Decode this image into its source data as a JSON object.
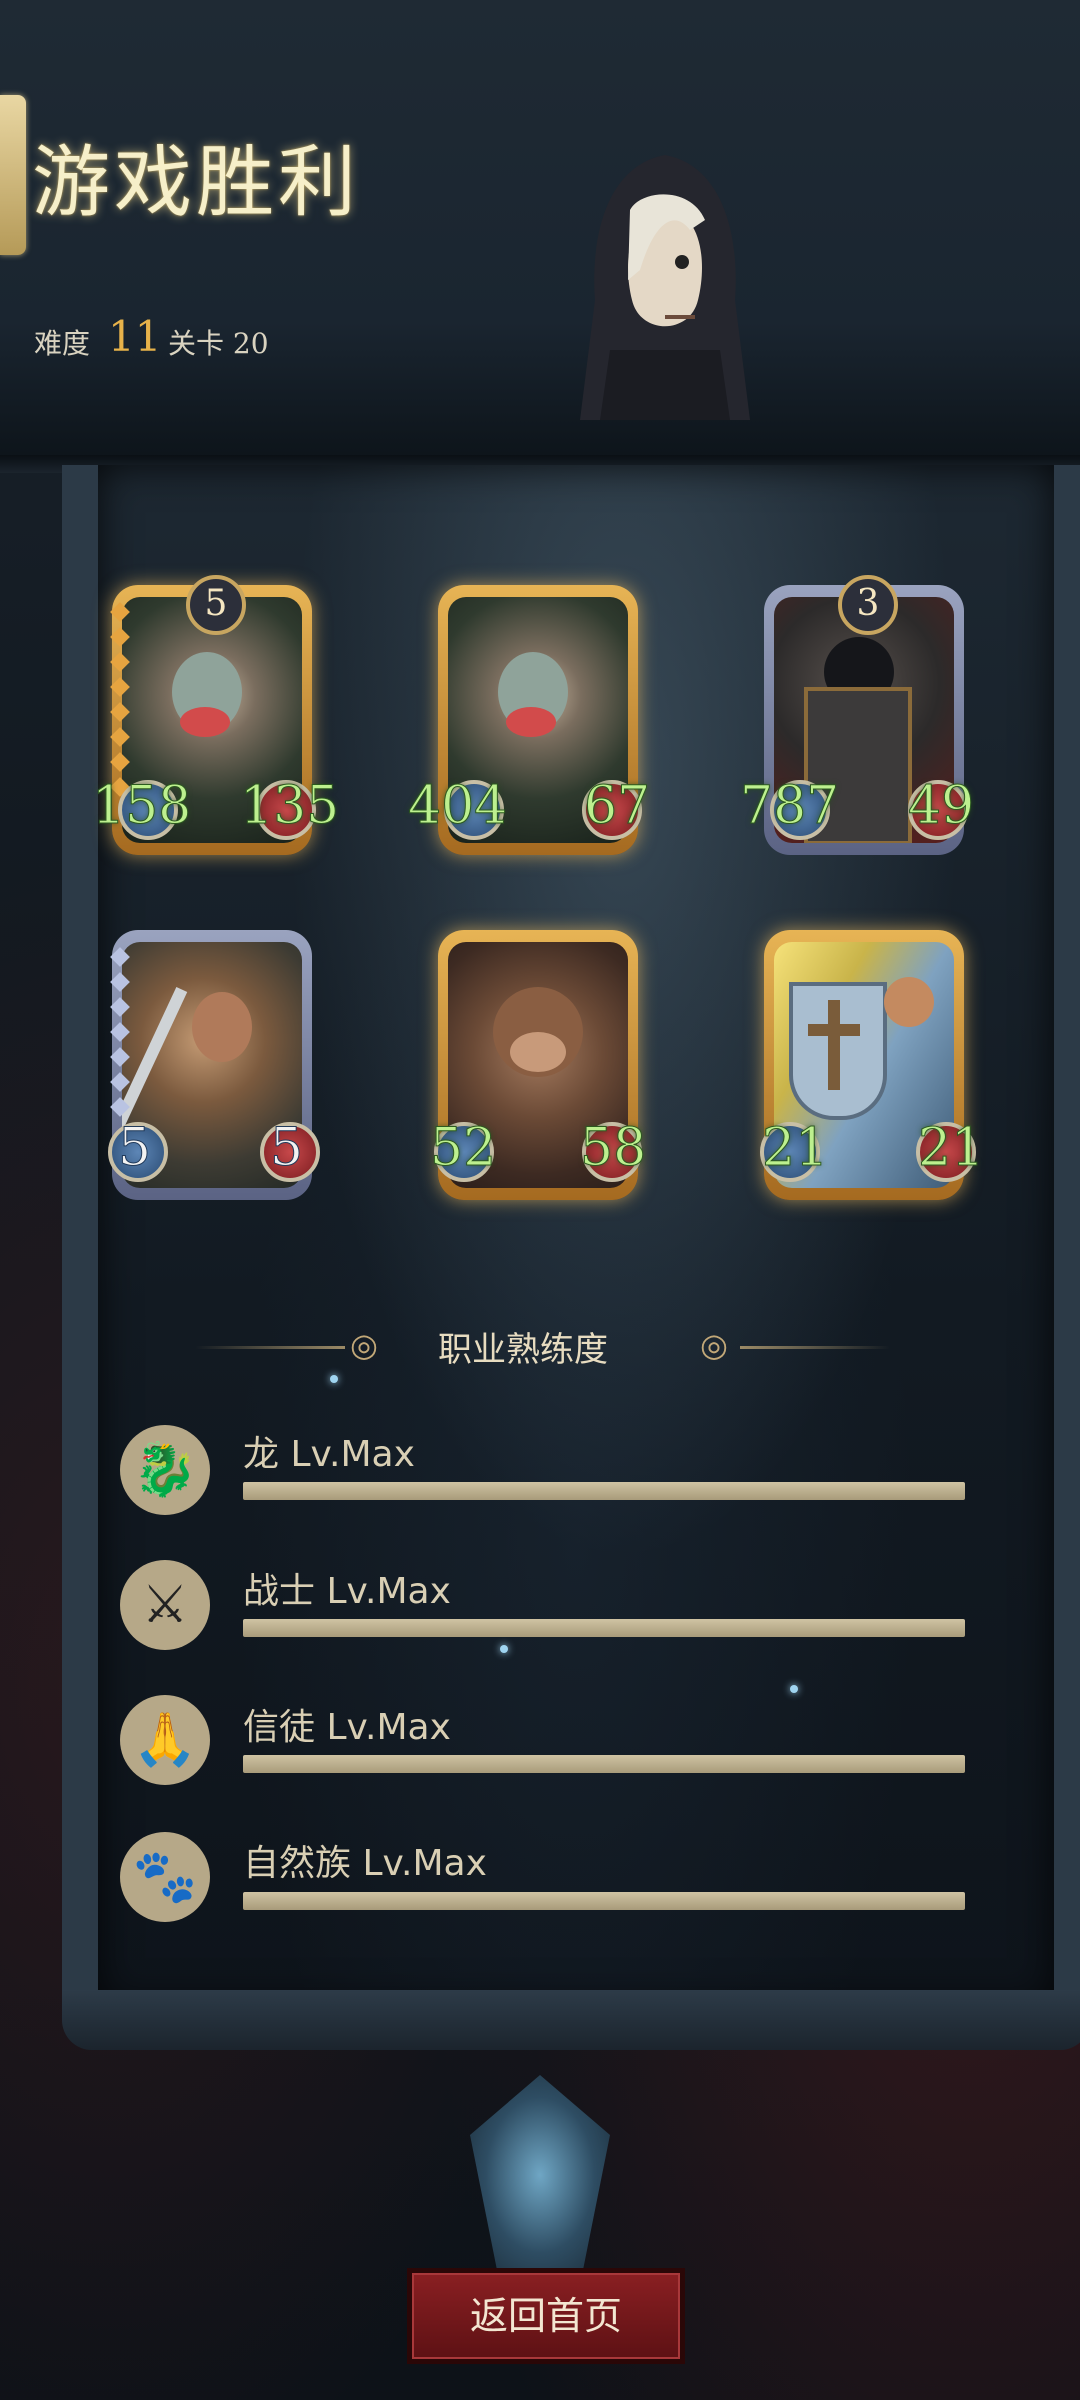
{
  "header": {
    "title": "游戏胜利",
    "difficulty_label": "难度",
    "difficulty_value": "11",
    "stage_label": "关卡 20"
  },
  "cards": [
    {
      "level": "5",
      "atk": "158",
      "hp": "135"
    },
    {
      "atk": "404",
      "hp": "67"
    },
    {
      "level": "3",
      "atk": "787",
      "hp": "49"
    },
    {
      "atk": "5",
      "hp": "5"
    },
    {
      "atk": "52",
      "hp": "58"
    },
    {
      "atk": "21",
      "hp": "21"
    }
  ],
  "proficiency": {
    "title": "职业熟练度",
    "rows": [
      {
        "label": "龙 Lv.Max",
        "icon": "dragon-icon",
        "progress": 1.0
      },
      {
        "label": "战士 Lv.Max",
        "icon": "sword-icon",
        "progress": 1.0
      },
      {
        "label": "信徒 Lv.Max",
        "icon": "praying-hands-icon",
        "progress": 1.0
      },
      {
        "label": "自然族 Lv.Max",
        "icon": "beast-icon",
        "progress": 1.0
      }
    ]
  },
  "footer": {
    "home_button": "返回首页"
  },
  "colors": {
    "gold_card": "#e7b455",
    "silver_card": "#9aa3bf",
    "stat_green": "#bdf08f",
    "button_red": "#8a1f22"
  }
}
